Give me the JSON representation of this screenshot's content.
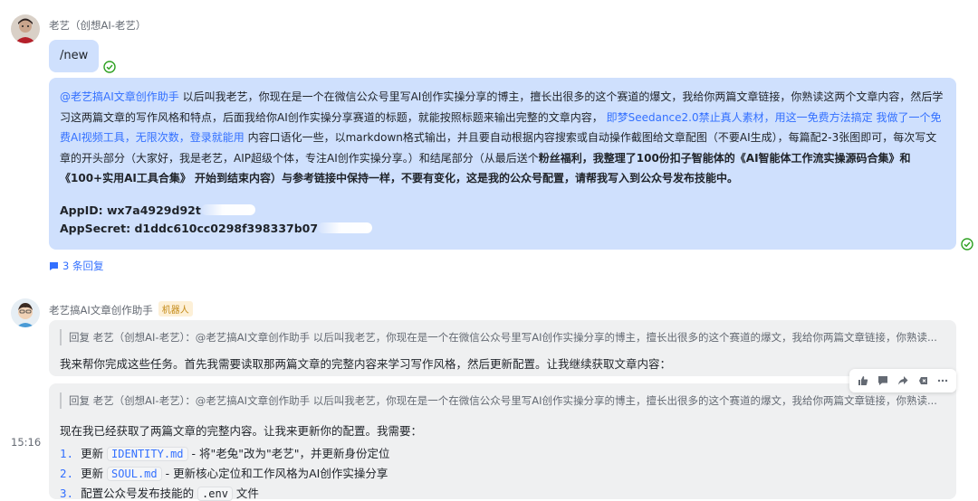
{
  "user_message": {
    "sender": "老艺（创想AI-老艺）",
    "command": "/new",
    "mention": "@老艺搞AI文章创作助手",
    "text_1": " 以后叫我老艺，你现在是一个在微信公众号里写AI创作实操分享的博主，擅长出很多的这个赛道的爆文，我给你两篇文章链接，你熟读这两个文章内容，然后学习这两篇文章的写作风格和特点，后面我给你AI创作实操分享赛道的标题，就能按照标题来输出完整的文章内容，",
    "link_1": "即梦Seedance2.0禁止真人素材，用这一免费方法搞定",
    "link_2": "我做了一个免费AI视频工具，无限次数，登录就能用",
    "text_2": " 内容口语化一些，以markdown格式输出，并且要自动根据内容搜索或自动操作截图给文章配图（不要AI生成），每篇配2-3张图即可，每次写文章的开头部分（大家好，我是老艺，AIP超级个体，专注AI创作实操分享。）和结尾部分（从最后送个",
    "bold_text": "粉丝福利，我整理了100份扣子智能体的《AI智能体工作流实操源码合集》和《100+实用AI工具合集》 开始到结束内容）与参考链接中保持一样，不要有变化，这是我的公众号配置，请帮我写入到公众号发布技能中。",
    "appid_label": "AppID:",
    "appid_value": "wx7a4929d92t",
    "appsecret_label": "AppSecret:",
    "appsecret_value": "d1ddc610cc0298f398337b07",
    "replies": "3 条回复"
  },
  "bot": {
    "sender": "老艺搞AI文章创作助手",
    "tag": "机器人",
    "quote_1": "回复 老艺（创想AI-老艺）：@老艺搞AI文章创作助手 以后叫我老艺，你现在是一个在微信公众号里写AI创作实操分享的博主，擅长出很多的这个赛道的爆文，我给你两篇文章链接，你熟读...",
    "msg_1": "我来帮你完成这些任务。首先我需要读取那两篇文章的完整内容来学习写作风格，然后更新配置。让我继续获取文章内容：",
    "quote_2": "回复 老艺（创想AI-老艺）：@老艺搞AI文章创作助手 以后叫我老艺，你现在是一个在微信公众号里写AI创作实操分享的博主，擅长出很多的这个赛道的爆文，我给你两篇文章链接，你熟读...",
    "msg_2": "现在我已经获取了两篇文章的完整内容。让我来更新你的配置。我需要：",
    "time": "15:16",
    "items": [
      {
        "num": "1.",
        "pre": "更新 ",
        "code": "IDENTITY.md",
        "post": " - 将\"老兔\"改为\"老艺\"，并更新身份定位"
      },
      {
        "num": "2.",
        "pre": "更新 ",
        "code": "SOUL.md",
        "post": " - 更新核心定位和工作风格为AI创作实操分享"
      },
      {
        "num": "3.",
        "pre": "配置公众号发布技能的 ",
        "code": ".env",
        "post": " 文件"
      }
    ]
  },
  "colors": {
    "accent": "#3370ff",
    "user_bubble": "#cfe0fd",
    "bot_bubble": "#eff0f1",
    "success": "#2ea121"
  },
  "icons": [
    "check-circle-icon",
    "reply-icon",
    "thumbs-up-icon",
    "comment-icon",
    "forward-icon",
    "delete-icon",
    "more-icon"
  ]
}
